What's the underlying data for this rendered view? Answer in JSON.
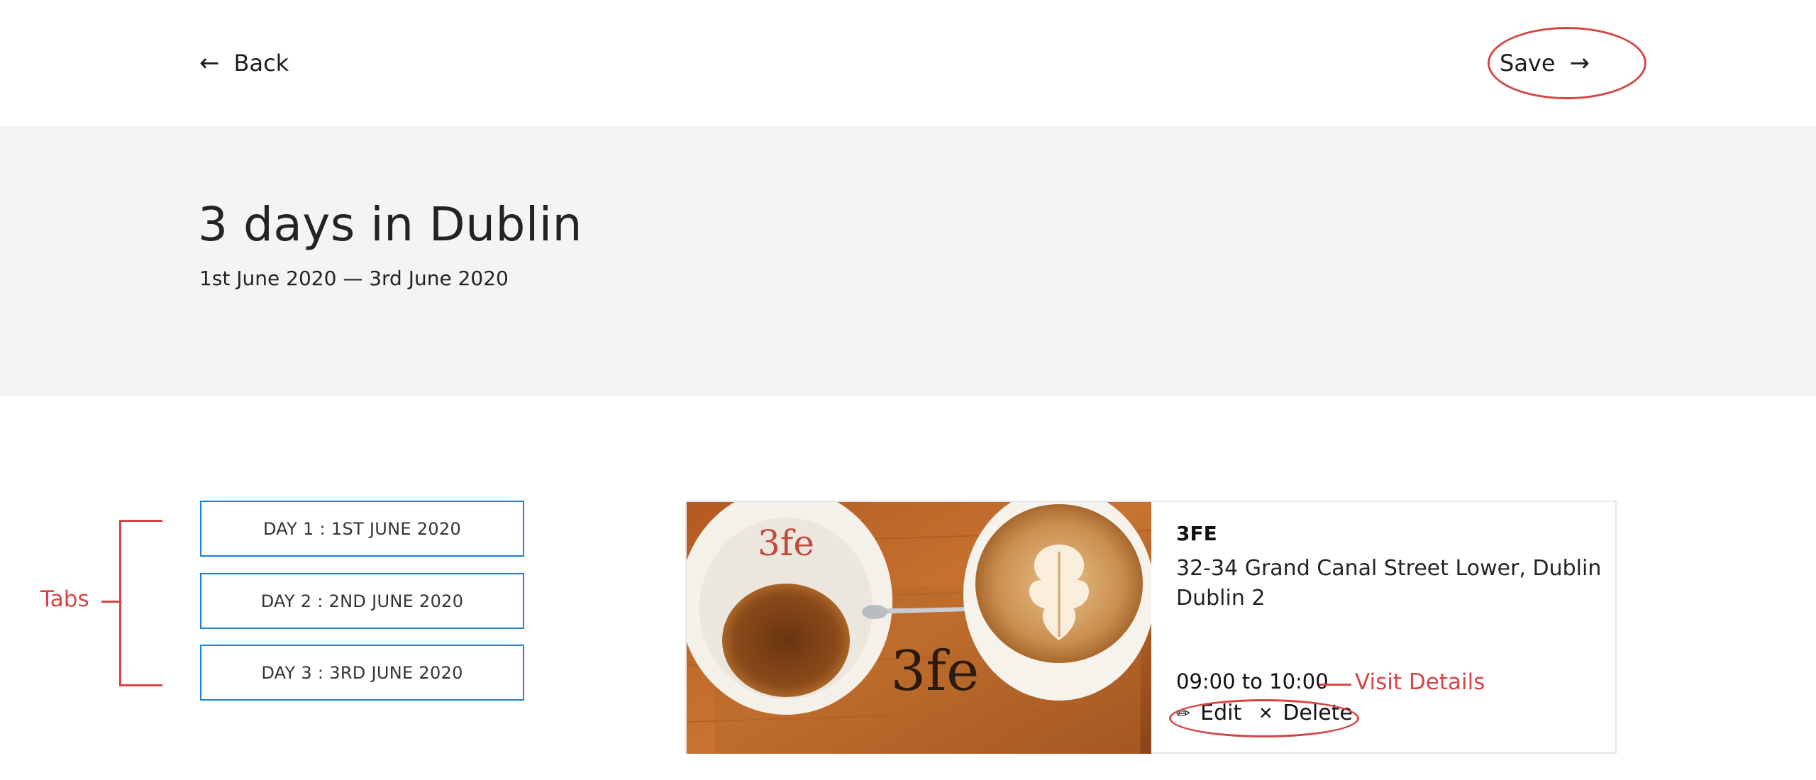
{
  "topbar": {
    "back_label": "Back",
    "save_label": "Save"
  },
  "trip": {
    "title": "3 days in Dublin",
    "dates": "1st June 2020 — 3rd June 2020"
  },
  "tabs": [
    {
      "label": "DAY 1 : 1ST JUNE 2020"
    },
    {
      "label": "DAY 2 : 2ND JUNE 2020"
    },
    {
      "label": "DAY 3 : 3RD JUNE 2020"
    }
  ],
  "annotations": {
    "tabs_label": "Tabs",
    "visit_details_label": "Visit Details",
    "color": "#d64545"
  },
  "visit": {
    "name": "3FE",
    "address_line1": "32-34 Grand Canal Street Lower, Dublin",
    "address_line2": "Dublin 2",
    "time": "09:00 to 10:00",
    "edit_label": "Edit",
    "delete_label": "Delete",
    "photo_logo_text": "3FE"
  },
  "colors": {
    "tab_border": "#1d7fd8",
    "hero_bg": "#f4f4f4",
    "annotation": "#d64545"
  },
  "icons": {
    "back": "arrow-left-icon",
    "save": "arrow-right-icon",
    "edit": "pencil-icon",
    "delete": "close-icon"
  }
}
